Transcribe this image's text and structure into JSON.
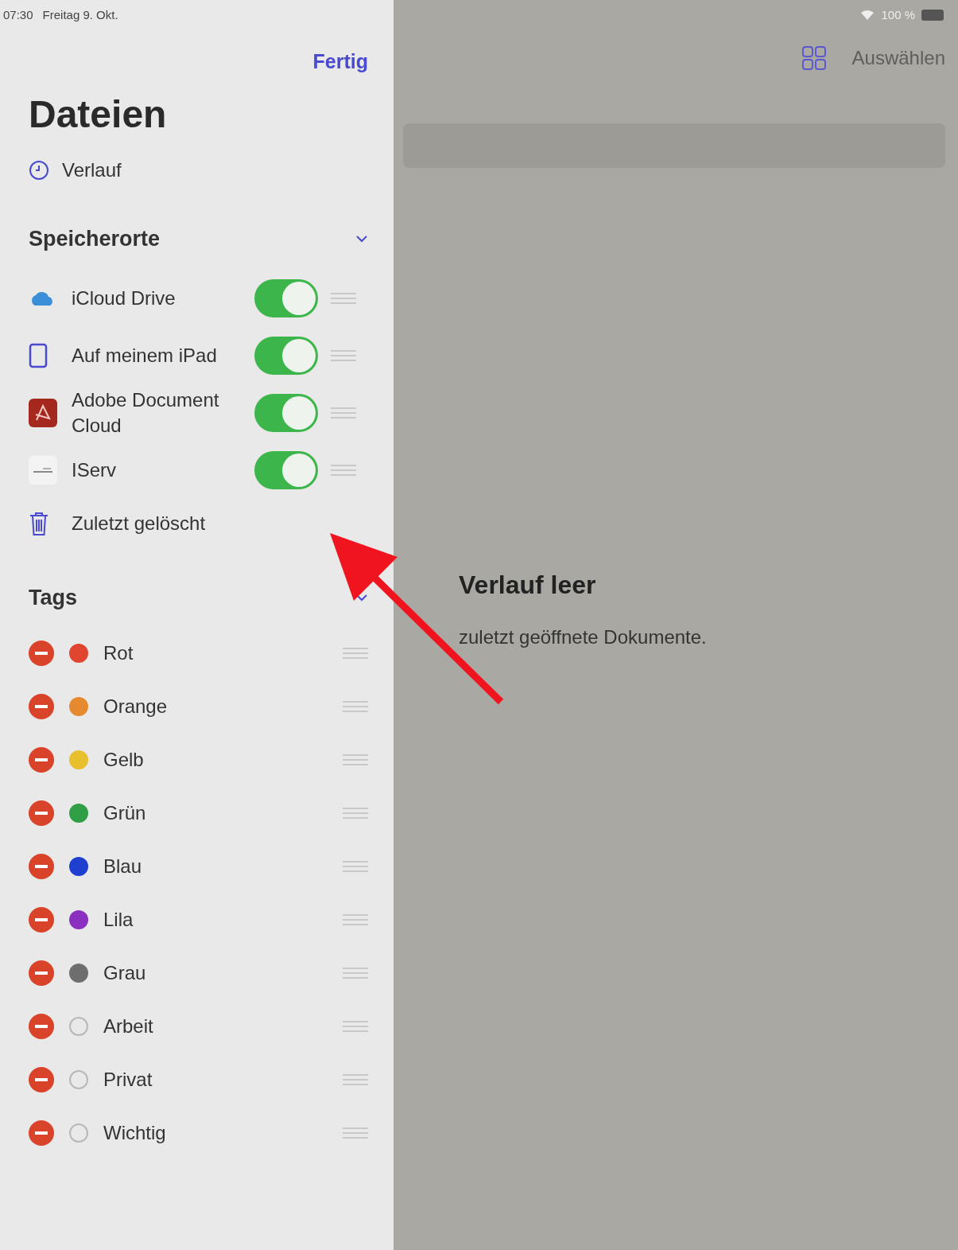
{
  "status_bar": {
    "time": "07:30",
    "date": "Freitag 9. Okt.",
    "battery": "100 %"
  },
  "sidebar": {
    "done_button": "Fertig",
    "title": "Dateien",
    "recents": "Verlauf",
    "locations": {
      "heading": "Speicherorte",
      "expanded": true,
      "items": [
        {
          "kind": "cloud",
          "label": "iCloud Drive",
          "on": true
        },
        {
          "kind": "tablet",
          "label": "Auf meinem iPad",
          "on": true
        },
        {
          "kind": "acrobat",
          "label": "Adobe Document Cloud",
          "on": true
        },
        {
          "kind": "iserv",
          "label": "IServ",
          "on": true
        }
      ],
      "deleted": "Zuletzt gelöscht"
    },
    "tags": {
      "heading": "Tags",
      "expanded": true,
      "items": [
        {
          "label": "Rot",
          "kind": "filled",
          "color": "#e0452f"
        },
        {
          "label": "Orange",
          "kind": "filled",
          "color": "#e58a2e"
        },
        {
          "label": "Gelb",
          "kind": "filled",
          "color": "#e8bf2c"
        },
        {
          "label": "Grün",
          "kind": "filled",
          "color": "#2f9e44"
        },
        {
          "label": "Blau",
          "kind": "filled",
          "color": "#1f3fd1"
        },
        {
          "label": "Lila",
          "kind": "filled",
          "color": "#8a2fc0"
        },
        {
          "label": "Grau",
          "kind": "filled",
          "color": "#6e6e6e"
        },
        {
          "label": "Arbeit",
          "kind": "outline"
        },
        {
          "label": "Privat",
          "kind": "outline"
        },
        {
          "label": "Wichtig",
          "kind": "outline"
        }
      ]
    }
  },
  "main": {
    "select_button": "Auswählen",
    "empty_title": "Verlauf leer",
    "empty_text": "zuletzt geöffnete Dokumente."
  }
}
